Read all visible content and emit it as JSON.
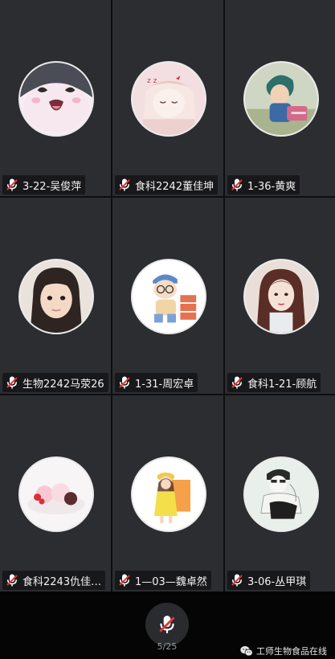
{
  "participants": [
    {
      "name": "3-22-吴俊萍",
      "avatar": "cartoon-hamster-avatar"
    },
    {
      "name": "食科2242董佳坤",
      "avatar": "anime-girl-sleeping-avatar"
    },
    {
      "name": "1-36-黄爽",
      "avatar": "anime-boy-avatar"
    },
    {
      "name": "生物2242马荥26",
      "avatar": "girl-photo-avatar"
    },
    {
      "name": "1-31-周宏卓",
      "avatar": "cartoon-boy-cap-avatar"
    },
    {
      "name": "食科1-21-顾航",
      "avatar": "illustrated-woman-avatar"
    },
    {
      "name": "食科2243仇佳…",
      "avatar": "dessert-plate-avatar"
    },
    {
      "name": "1—03—魏卓然",
      "avatar": "cartoon-girl-yellow-avatar"
    },
    {
      "name": "3-06-丛甲琪",
      "avatar": "sketch-couple-avatar"
    }
  ],
  "footer": {
    "page_indicator": "5/25",
    "watermark": "工师生物食品在线",
    "mic_state": "muted"
  },
  "colors": {
    "tile_bg": "#2c2d30",
    "mute_red": "#e2373a"
  }
}
